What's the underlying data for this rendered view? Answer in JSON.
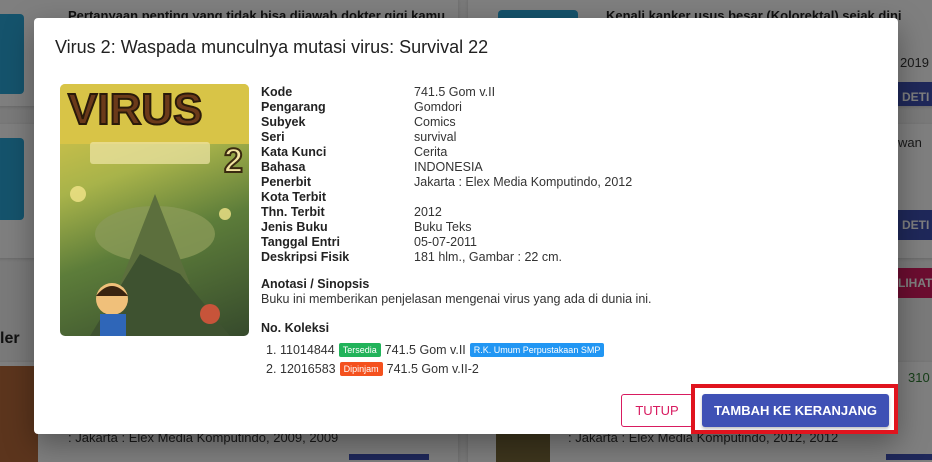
{
  "background": {
    "cards": [
      {
        "title": "Pertanyaan penting yang tidak bisa dijawab dokter gigi kamu"
      },
      {
        "title": "Kenali kanker usus besar (Kolorektal) sejak dini",
        "year": "2019",
        "button": "DETI"
      },
      {
        "snippet": "wan",
        "button": "DETI"
      },
      {
        "button": "LIHAT"
      },
      {
        "count": "310"
      }
    ],
    "left_heading_fragment": "ler",
    "bottom_left_text": ": Jakarta : Elex Media Komputindo, 2009, 2009",
    "bottom_right_text": ": Jakarta : Elex Media Komputindo, 2012, 2012"
  },
  "modal": {
    "title": "Virus 2: Waspada munculnya mutasi virus: Survival 22",
    "cover": {
      "alt": "VIRUS 2 book cover",
      "cover_text": "VIRUS",
      "volume": "2"
    },
    "details": [
      {
        "label": "Kode",
        "value": "741.5 Gom v.II"
      },
      {
        "label": "Pengarang",
        "value": "Gomdori"
      },
      {
        "label": "Subyek",
        "value": "Comics"
      },
      {
        "label": "Seri",
        "value": "survival"
      },
      {
        "label": "Kata Kunci",
        "value": "Cerita"
      },
      {
        "label": "Bahasa",
        "value": "INDONESIA"
      },
      {
        "label": "Penerbit",
        "value": "Jakarta : Elex Media Komputindo, 2012"
      },
      {
        "label": "Kota Terbit",
        "value": ""
      },
      {
        "label": "Thn. Terbit",
        "value": "2012"
      },
      {
        "label": "Jenis Buku",
        "value": "Buku Teks"
      },
      {
        "label": "Tanggal Entri",
        "value": "05-07-2011"
      },
      {
        "label": "Deskripsi Fisik",
        "value": "181 hlm., Gambar : 22 cm."
      }
    ],
    "synopsis": {
      "heading": "Anotasi / Sinopsis",
      "text": "Buku ini memberikan penjelasan mengenai virus yang ada di dunia ini."
    },
    "collection": {
      "heading": "No. Koleksi",
      "items": [
        {
          "number": "1.",
          "id": "11014844",
          "status": "Tersedia",
          "call_no": "741.5 Gom v.II",
          "location": "R.K. Umum Perpustakaan SMP"
        },
        {
          "number": "2.",
          "id": "12016583",
          "status": "Dipinjam",
          "call_no": "741.5 Gom v.II-2",
          "location": ""
        }
      ]
    },
    "buttons": {
      "close": "TUTUP",
      "add_to_cart": "TAMBAH KE KERANJANG"
    }
  },
  "colors": {
    "primary": "#3f51b5",
    "accent": "#d81b60",
    "available": "#21b35a",
    "borrowed": "#f4511e",
    "location_badge": "#2196f3",
    "highlight": "#e0141e"
  }
}
